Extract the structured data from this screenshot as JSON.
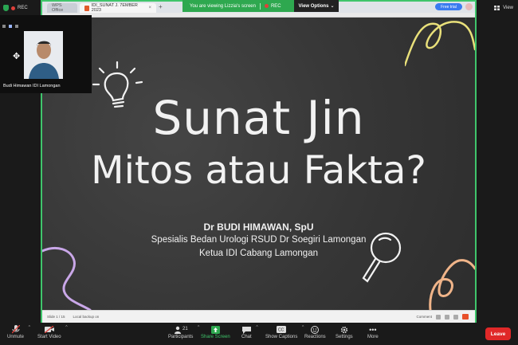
{
  "meeting": {
    "rec_label": "REC",
    "view_label": "View",
    "banner_text": "You are viewing Lizzia's screen",
    "banner_rec": "REC",
    "view_options": "View Options"
  },
  "browser": {
    "tabs": [
      {
        "label": "WPS Office"
      },
      {
        "label": "IDI_SUNAT J. 7EMBER 2023"
      }
    ],
    "free_trial": "Free trial"
  },
  "slide": {
    "title_line1": "Sunat Jin",
    "title_line2": "Mitos atau Fakta?",
    "author": "Dr BUDI HIMAWAN, SpU",
    "role1": "Spesialis Bedan Urologi RSUD Dr Soegiri Lamongan",
    "role2": "Ketua IDI Cabang Lamongan"
  },
  "statusbar": {
    "slide_info": "Slide 1 / 15",
    "backup": "Local backup on",
    "comment": "Comment"
  },
  "participant": {
    "name": "Budi Himawan IDI Lamongan"
  },
  "controls": {
    "unmute": "Unmute",
    "start_video": "Start Video",
    "participants": "Participants",
    "participant_count": "21",
    "share_screen": "Share Screen",
    "chat": "Chat",
    "show_captions": "Show Captions",
    "reactions": "Reactions",
    "settings": "Settings",
    "more": "More",
    "leave": "Leave"
  },
  "colors": {
    "share_border": "#3fc56b",
    "leave": "#e02828",
    "slide_bg": "#363636"
  }
}
